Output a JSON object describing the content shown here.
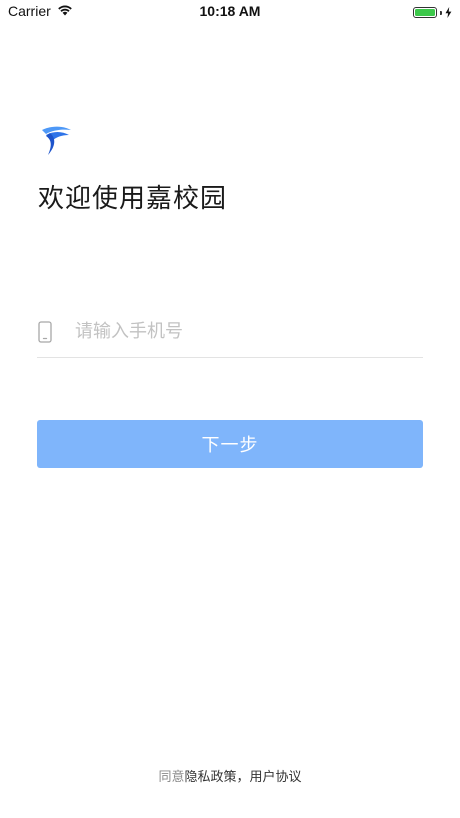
{
  "status_bar": {
    "carrier": "Carrier",
    "time": "10:18 AM",
    "battery_color": "#3cc84a"
  },
  "logo": {
    "icon": "jiaxiaoyuan-logo-icon",
    "colors": [
      "#3a86f5",
      "#1a4fc8"
    ]
  },
  "welcome_title": "欢迎使用嘉校园",
  "phone_field": {
    "icon": "mobile-phone-icon",
    "placeholder": "请输入手机号",
    "value": ""
  },
  "next_button": {
    "label": "下一步",
    "color": "#7fb5fb"
  },
  "agreement": {
    "prefix": "同意",
    "privacy_policy": "隐私政策",
    "separator": "，",
    "user_agreement": "用户协议"
  }
}
